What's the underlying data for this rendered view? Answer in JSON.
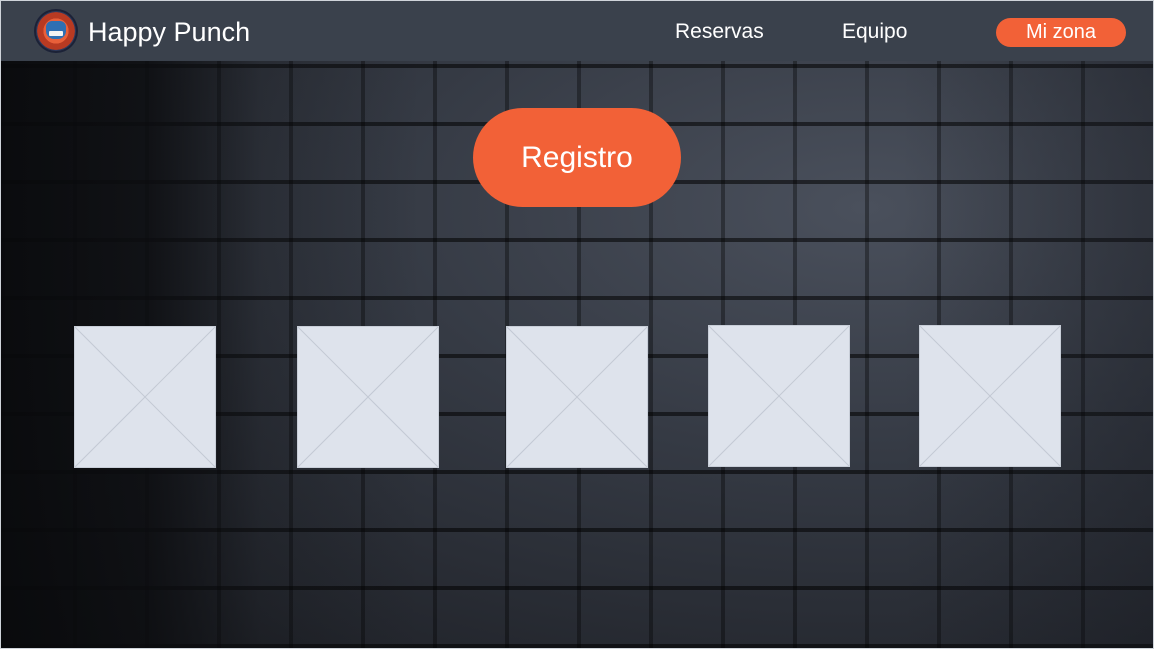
{
  "navbar": {
    "brand": "Happy Punch",
    "logo_icon": "happy-punch-logo",
    "links": [
      {
        "label": "Reservas"
      },
      {
        "label": "Equipo"
      }
    ],
    "cta_label": "Mi zona"
  },
  "hero": {
    "register_label": "Registro",
    "image_placeholders": 5
  },
  "colors": {
    "accent": "#f26137",
    "navbar": "#3a414c",
    "placeholder": "#dee3ec"
  }
}
